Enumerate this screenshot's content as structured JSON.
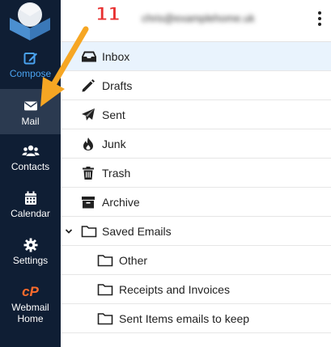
{
  "step_number": "11",
  "account_email": "chris@examplehome.uk",
  "sidebar": {
    "items": [
      {
        "label": "Compose",
        "icon": "compose-icon"
      },
      {
        "label": "Mail",
        "icon": "envelope-icon"
      },
      {
        "label": "Contacts",
        "icon": "users-icon"
      },
      {
        "label": "Calendar",
        "icon": "calendar-icon"
      },
      {
        "label": "Settings",
        "icon": "gear-icon"
      },
      {
        "label_line1": "Webmail",
        "label_line2": "Home",
        "icon": "cpanel-icon"
      }
    ],
    "cpanel_logo_text": "cP",
    "active": "Mail"
  },
  "folders": [
    {
      "label": "Inbox",
      "icon": "inbox-icon",
      "selected": true
    },
    {
      "label": "Drafts",
      "icon": "pencil-icon"
    },
    {
      "label": "Sent",
      "icon": "paper-plane-icon"
    },
    {
      "label": "Junk",
      "icon": "fire-icon"
    },
    {
      "label": "Trash",
      "icon": "trash-icon"
    },
    {
      "label": "Archive",
      "icon": "archive-box-icon"
    },
    {
      "label": "Saved Emails",
      "icon": "folder-icon",
      "expanded": true,
      "children": [
        {
          "label": "Other",
          "icon": "folder-icon"
        },
        {
          "label": "Receipts and Invoices",
          "icon": "folder-icon"
        },
        {
          "label": "Sent Items emails to keep",
          "icon": "folder-icon"
        }
      ]
    }
  ],
  "colors": {
    "sidebar_bg": "#0f1e34",
    "accent": "#4aa3f0",
    "selected_row": "#e9f3fd",
    "arrow": "#f6a623",
    "step_badge": "#e83030"
  }
}
